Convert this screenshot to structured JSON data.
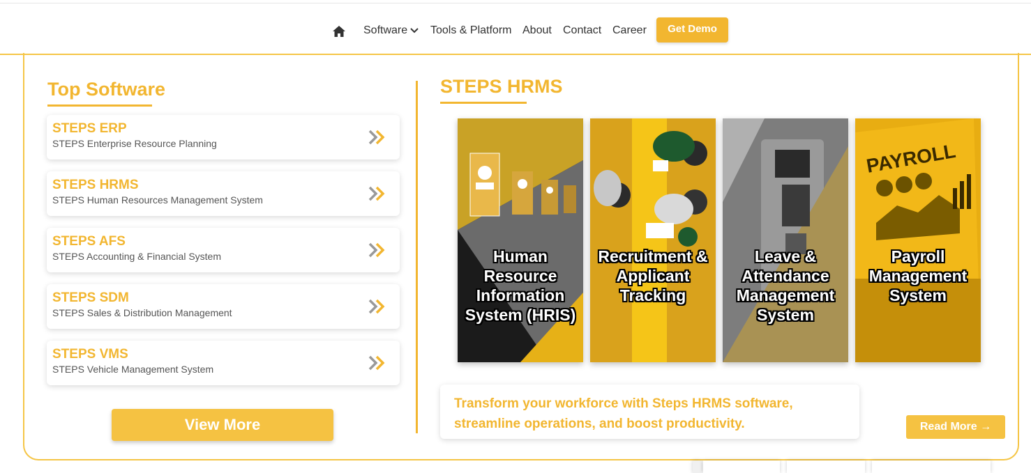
{
  "nav": {
    "home_icon": "home-icon",
    "items": [
      {
        "label": "Software",
        "has_dropdown": true
      },
      {
        "label": "Tools & Platform"
      },
      {
        "label": "About"
      },
      {
        "label": "Contact"
      },
      {
        "label": "Career"
      }
    ],
    "demo_button": "Get Demo"
  },
  "left": {
    "title": "Top Software",
    "cards": [
      {
        "title": "STEPS ERP",
        "subtitle": "STEPS Enterprise Resource Planning"
      },
      {
        "title": "STEPS HRMS",
        "subtitle": "STEPS Human Resources Management System"
      },
      {
        "title": "STEPS AFS",
        "subtitle": "STEPS Accounting & Financial System"
      },
      {
        "title": "STEPS SDM",
        "subtitle": "STEPS Sales & Distribution Management"
      },
      {
        "title": "STEPS VMS",
        "subtitle": "STEPS Vehicle Management System"
      }
    ],
    "view_more": "View More"
  },
  "right": {
    "title": "STEPS HRMS",
    "tiles": [
      {
        "label": "Human Resource Information System (HRIS)"
      },
      {
        "label": "Recruitment & Applicant Tracking"
      },
      {
        "label": "Leave & Attendance Management System"
      },
      {
        "label": "Payroll Management System",
        "image_text": "PAYROLL"
      }
    ],
    "promo": "Transform your workforce with Steps HRMS software, streamline operations, and boost productivity.",
    "read_more": "Read More →"
  },
  "colors": {
    "accent": "#f2b630",
    "text": "#333333",
    "sub": "#555555"
  }
}
